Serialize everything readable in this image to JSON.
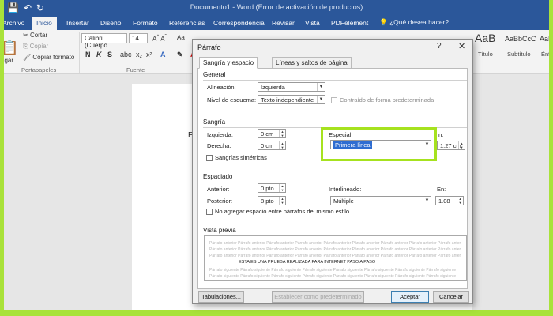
{
  "window": {
    "title": "Documento1 - Word (Error de activación de productos)"
  },
  "ribbon_tabs": [
    "Archivo",
    "Inicio",
    "Insertar",
    "Diseño",
    "Formato",
    "Referencias",
    "Correspondencia",
    "Revisar",
    "Vista",
    "PDFelement"
  ],
  "tell_me": "¿Qué desea hacer?",
  "clipboard": {
    "cut": "Cortar",
    "copy": "Copiar",
    "format_painter": "Copiar formato",
    "paste": "egar",
    "group": "Portapapeles"
  },
  "font": {
    "name": "Calibri (Cuerpo",
    "size": "14",
    "grow": "Aa",
    "group": "Fuente",
    "bold": "N",
    "italic": "K",
    "underline": "S"
  },
  "styles": {
    "sample1": "AaBbCcC",
    "sample2": "AaBbCcC",
    "label1": "Título",
    "label2": "Subtítulo",
    "label3": "Énfa"
  },
  "document": {
    "text": "ES"
  },
  "dialog": {
    "title": "Párrafo",
    "help": "?",
    "close": "✕",
    "tabs": [
      "Sangría y espacio",
      "Líneas y saltos de página"
    ],
    "general": {
      "heading": "General",
      "alignment_label": "Alineación:",
      "alignment_value": "Izquierda",
      "outline_label": "Nivel de esquema:",
      "outline_value": "Texto independiente",
      "collapsed_label": "Contraído de forma predeterminada"
    },
    "indent": {
      "heading": "Sangría",
      "left_label": "Izquierda:",
      "left_value": "0 cm",
      "right_label": "Derecha:",
      "right_value": "0 cm",
      "special_label": "Especial:",
      "special_value": "Primera línea",
      "by_label": "n:",
      "by_value": "1.27 cm",
      "mirror_label": "Sangrías simétricas"
    },
    "spacing": {
      "heading": "Espaciado",
      "before_label": "Anterior:",
      "before_value": "0 pto",
      "after_label": "Posterior:",
      "after_value": "8 pto",
      "line_label": "Interlineado:",
      "line_value": "Múltiple",
      "at_label": "En:",
      "at_value": "1.08",
      "no_space_label": "No agregar espacio entre párrafos del mismo estilo"
    },
    "preview": {
      "heading": "Vista previa",
      "prev_text": "Párrafo anterior Párrafo anterior Párrafo anterior Párrafo anterior Párrafo anterior Párrafo anterior Párrafo anterior Párrafo anterior Párrafo anterior",
      "main_text": "ESTA ES UNA PRUEBA REALIZADA PARA INTERNET PASO A PASO",
      "next_text": "Párrafo siguiente Párrafo siguiente Párrafo siguiente Párrafo siguiente Párrafo siguiente Párrafo siguiente Párrafo siguiente Párrafo siguiente"
    },
    "buttons": {
      "tabs": "Tabulaciones...",
      "default": "Establecer como predeterminado",
      "ok": "Aceptar",
      "cancel": "Cancelar"
    }
  },
  "colors": {
    "word_blue": "#2b579a",
    "highlight_green": "#a6e21f",
    "selection": "#2f6dd1"
  }
}
